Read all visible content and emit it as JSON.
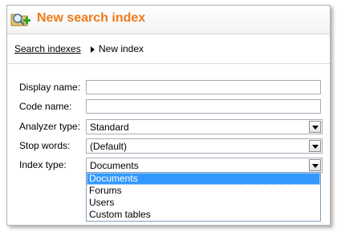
{
  "header": {
    "title": "New search index",
    "icon": "search-add-icon"
  },
  "breadcrumb": {
    "parent_link": "Search indexes",
    "current": "New index"
  },
  "form": {
    "display_name": {
      "label": "Display name:",
      "value": ""
    },
    "code_name": {
      "label": "Code name:",
      "value": ""
    },
    "analyzer_type": {
      "label": "Analyzer type:",
      "value": "Standard"
    },
    "stop_words": {
      "label": "Stop words:",
      "value": "(Default)"
    },
    "index_type": {
      "label": "Index type:",
      "value": "Documents",
      "options": [
        "Documents",
        "Forums",
        "Users",
        "Custom tables"
      ],
      "highlighted_option": "Documents"
    }
  },
  "colors": {
    "title": "#f07a1a",
    "selection": "#3399ff"
  }
}
